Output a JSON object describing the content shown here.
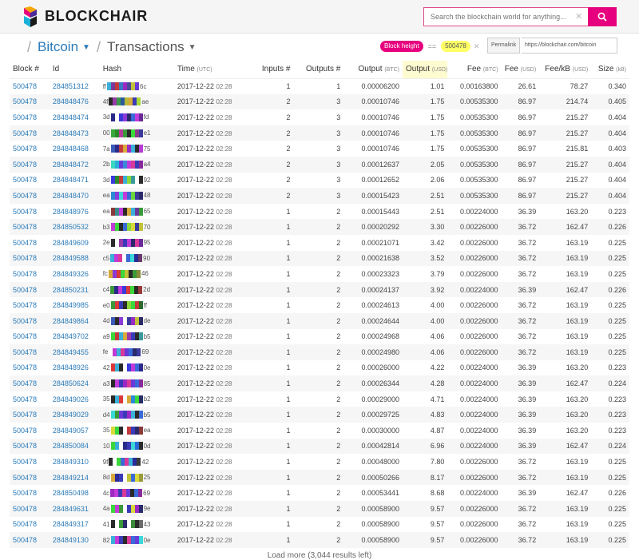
{
  "header": {
    "logo_text": "BLOCKCHAIR",
    "search_placeholder": "Search the blockchain world for anything..."
  },
  "breadcrumb": {
    "chain": "Bitcoin",
    "section": "Transactions"
  },
  "filter": {
    "field": "Block height",
    "operator": "==",
    "value": "500478"
  },
  "permalink": {
    "label": "Permalink",
    "url": "https://blockchair.com/bitcoin"
  },
  "columns": {
    "block": "Block #",
    "id": "Id",
    "hash": "Hash",
    "time": "Time",
    "time_unit": "(UTC)",
    "inputs": "Inputs #",
    "outputs": "Outputs #",
    "output_btc": "Output",
    "output_btc_unit": "(BTC)",
    "output_usd": "Output",
    "output_usd_unit": "(USD)",
    "fee_btc": "Fee",
    "fee_btc_unit": "(BTC)",
    "fee_usd": "Fee",
    "fee_usd_unit": "(USD)",
    "fee_kb": "Fee/kB",
    "fee_kb_unit": "(USD)",
    "size": "Size",
    "size_unit": "(kB)"
  },
  "rows": [
    {
      "block": "500478",
      "id": "284851312",
      "hash_start": "ff",
      "hash_end": "6c",
      "date": "2017-12-22",
      "time": "02:28",
      "inputs": "1",
      "outputs": "1",
      "output_btc": "0.00006200",
      "output_usd": "1.01",
      "fee_btc": "0.00163800",
      "fee_usd": "26.61",
      "fee_kb": "78.27",
      "size": "0.340",
      "colors": [
        "#3ab0d8",
        "#7a3a9a",
        "#c23a3a",
        "#3a7ac2",
        "#9a2ac2",
        "#4a4a9a",
        "#c2c23a",
        "#6a3ad8"
      ]
    },
    {
      "block": "500478",
      "id": "284848476",
      "hash_start": "4f",
      "hash_end": "ae",
      "date": "2017-12-22",
      "time": "02:28",
      "inputs": "2",
      "outputs": "3",
      "output_btc": "0.00010746",
      "output_usd": "1.75",
      "fee_btc": "0.00535300",
      "fee_usd": "86.97",
      "fee_kb": "214.74",
      "size": "0.405",
      "colors": [
        "#2a2a2a",
        "#9a3aa8",
        "#3a9a4a",
        "#2a5a9a",
        "#b8b83a",
        "#d8a83a",
        "#3a3ab8",
        "#a8d83a"
      ]
    },
    {
      "block": "500478",
      "id": "284848474",
      "hash_start": "3d",
      "hash_end": "fd",
      "date": "2017-12-22",
      "time": "02:28",
      "inputs": "2",
      "outputs": "3",
      "output_btc": "0.00010746",
      "output_usd": "1.75",
      "fee_btc": "0.00535300",
      "fee_usd": "86.97",
      "fee_kb": "215.27",
      "size": "0.404",
      "colors": [
        "#2a2a8a",
        "#ffffff",
        "#3a3ad8",
        "#8a3ad8",
        "#2a2a6a",
        "#3a6ad8",
        "#c23ad8",
        "#6a2a9a"
      ]
    },
    {
      "block": "500478",
      "id": "284848473",
      "hash_start": "00",
      "hash_end": "e1",
      "date": "2017-12-22",
      "time": "02:28",
      "inputs": "2",
      "outputs": "3",
      "output_btc": "0.00010746",
      "output_usd": "1.75",
      "fee_btc": "0.00535300",
      "fee_usd": "86.97",
      "fee_kb": "215.27",
      "size": "0.404",
      "colors": [
        "#3aa83a",
        "#2a8a2a",
        "#b83a9a",
        "#3a9a3a",
        "#2a2a2a",
        "#3ad83a",
        "#8a3a8a",
        "#3a3a9a"
      ]
    },
    {
      "block": "500478",
      "id": "284848468",
      "hash_start": "7a",
      "hash_end": "75",
      "date": "2017-12-22",
      "time": "02:28",
      "inputs": "2",
      "outputs": "3",
      "output_btc": "0.00010746",
      "output_usd": "1.75",
      "fee_btc": "0.00535300",
      "fee_usd": "86.97",
      "fee_kb": "215.81",
      "size": "0.403",
      "colors": [
        "#3a5ab8",
        "#2a2a8a",
        "#c23a3a",
        "#d8a83a",
        "#9a2ac2",
        "#3ab0d8",
        "#2a2a2a",
        "#b83ad8"
      ]
    },
    {
      "block": "500478",
      "id": "284848472",
      "hash_start": "2b",
      "hash_end": "a4",
      "date": "2017-12-22",
      "time": "02:28",
      "inputs": "2",
      "outputs": "3",
      "output_btc": "0.00012637",
      "output_usd": "2.05",
      "fee_btc": "0.00535300",
      "fee_usd": "86.97",
      "fee_kb": "215.27",
      "size": "0.404",
      "colors": [
        "#3ad8c2",
        "#2ab0d8",
        "#6a3ad8",
        "#3a8ad8",
        "#c23ad8",
        "#d83a9a",
        "#3a3ab8",
        "#8a2a9a"
      ]
    },
    {
      "block": "500478",
      "id": "284848471",
      "hash_start": "3d",
      "hash_end": "92",
      "date": "2017-12-22",
      "time": "02:28",
      "inputs": "2",
      "outputs": "3",
      "output_btc": "0.00012652",
      "output_usd": "2.06",
      "fee_btc": "0.00535300",
      "fee_usd": "86.97",
      "fee_kb": "215.27",
      "size": "0.404",
      "colors": [
        "#3a3ad8",
        "#2a8a2a",
        "#c23a3a",
        "#3ab0d8",
        "#8ad83a",
        "#3a9a9a",
        "#ffffff",
        "#2a2a2a"
      ]
    },
    {
      "block": "500478",
      "id": "284848470",
      "hash_start": "ea",
      "hash_end": "48",
      "date": "2017-12-22",
      "time": "02:28",
      "inputs": "2",
      "outputs": "3",
      "output_btc": "0.00015423",
      "output_usd": "2.51",
      "fee_btc": "0.00535300",
      "fee_usd": "86.97",
      "fee_kb": "215.27",
      "size": "0.404",
      "colors": [
        "#2a8ad8",
        "#8a3ad8",
        "#3ad8d8",
        "#c23ad8",
        "#3a6ad8",
        "#6ad83a",
        "#3a3a9a",
        "#2a2a6a"
      ]
    },
    {
      "block": "500478",
      "id": "284848976",
      "hash_start": "ea",
      "hash_end": "65",
      "date": "2017-12-22",
      "time": "02:28",
      "inputs": "1",
      "outputs": "2",
      "output_btc": "0.00015443",
      "output_usd": "2.51",
      "fee_btc": "0.00224000",
      "fee_usd": "36.39",
      "fee_kb": "163.20",
      "size": "0.223",
      "colors": [
        "#8a3a3a",
        "#3a8a8a",
        "#c23ad8",
        "#2a2a2a",
        "#d8a83a",
        "#3ab0d8",
        "#6a3a9a",
        "#3a9a3a"
      ]
    },
    {
      "block": "500478",
      "id": "284850532",
      "hash_start": "b3",
      "hash_end": "70",
      "date": "2017-12-22",
      "time": "02:28",
      "inputs": "1",
      "outputs": "2",
      "output_btc": "0.00020292",
      "output_usd": "3.30",
      "fee_btc": "0.00226000",
      "fee_usd": "36.72",
      "fee_kb": "162.47",
      "size": "0.226",
      "colors": [
        "#c23ad8",
        "#3ad83a",
        "#2a2a2a",
        "#3a6ad8",
        "#8ad83a",
        "#d8d83a",
        "#3a3a9a",
        "#c2c23a"
      ]
    },
    {
      "block": "500478",
      "id": "284849609",
      "hash_start": "2e",
      "hash_end": "95",
      "date": "2017-12-22",
      "time": "02:28",
      "inputs": "1",
      "outputs": "2",
      "output_btc": "0.00021071",
      "output_usd": "3.42",
      "fee_btc": "0.00226000",
      "fee_usd": "36.72",
      "fee_kb": "163.19",
      "size": "0.225",
      "colors": [
        "#2a2a2a",
        "#ffffff",
        "#9a3aa8",
        "#3a3ab8",
        "#c23ad8",
        "#2a2a6a",
        "#d83a9a",
        "#6a2a9a"
      ]
    },
    {
      "block": "500478",
      "id": "284849588",
      "hash_start": "c5",
      "hash_end": "90",
      "date": "2017-12-22",
      "time": "02:28",
      "inputs": "1",
      "outputs": "2",
      "output_btc": "0.00021638",
      "output_usd": "3.52",
      "fee_btc": "0.00226000",
      "fee_usd": "36.72",
      "fee_kb": "163.19",
      "size": "0.225",
      "colors": [
        "#3ab0d8",
        "#c23ad8",
        "#d83a9a",
        "#ffffff",
        "#3a6ad8",
        "#3ad8d8",
        "#2a2a9a",
        "#6a3a6a"
      ]
    },
    {
      "block": "500478",
      "id": "284849326",
      "hash_start": "fc",
      "hash_end": "46",
      "date": "2017-12-22",
      "time": "02:28",
      "inputs": "1",
      "outputs": "2",
      "output_btc": "0.00023323",
      "output_usd": "3.79",
      "fee_btc": "0.00226000",
      "fee_usd": "36.72",
      "fee_kb": "163.19",
      "size": "0.225",
      "colors": [
        "#d8a83a",
        "#8a3ad8",
        "#d83a3a",
        "#3ad83a",
        "#c2c23a",
        "#2a2a2a",
        "#3a9a3a",
        "#8a8a3a"
      ]
    },
    {
      "block": "500478",
      "id": "284850231",
      "hash_start": "c4",
      "hash_end": "2d",
      "date": "2017-12-22",
      "time": "02:28",
      "inputs": "1",
      "outputs": "2",
      "output_btc": "0.00024137",
      "output_usd": "3.92",
      "fee_btc": "0.00224000",
      "fee_usd": "36.39",
      "fee_kb": "162.47",
      "size": "0.226",
      "colors": [
        "#3a9a3a",
        "#2a2a8a",
        "#c23ad8",
        "#3a3ad8",
        "#d83a3a",
        "#3ad83a",
        "#2a2a2a",
        "#9a3a3a"
      ]
    },
    {
      "block": "500478",
      "id": "284849985",
      "hash_start": "e0",
      "hash_end": "ff",
      "date": "2017-12-22",
      "time": "02:28",
      "inputs": "1",
      "outputs": "2",
      "output_btc": "0.00024613",
      "output_usd": "4.00",
      "fee_btc": "0.00226000",
      "fee_usd": "36.72",
      "fee_kb": "163.19",
      "size": "0.225",
      "colors": [
        "#3a9a3a",
        "#d83a3a",
        "#3a3ab8",
        "#2a2a2a",
        "#8ad83a",
        "#3ad83a",
        "#c23a3a",
        "#2a6a2a"
      ]
    },
    {
      "block": "500478",
      "id": "284849864",
      "hash_start": "4d",
      "hash_end": "de",
      "date": "2017-12-22",
      "time": "02:28",
      "inputs": "1",
      "outputs": "2",
      "output_btc": "0.00024644",
      "output_usd": "4.00",
      "fee_btc": "0.00226000",
      "fee_usd": "36.72",
      "fee_kb": "163.19",
      "size": "0.225",
      "colors": [
        "#3a5ab8",
        "#2a2a2a",
        "#8a3ad8",
        "#ffffff",
        "#3a3a9a",
        "#9a2ac2",
        "#c2c23a",
        "#2a2a6a"
      ]
    },
    {
      "block": "500478",
      "id": "284849702",
      "hash_start": "a9",
      "hash_end": "b5",
      "date": "2017-12-22",
      "time": "02:28",
      "inputs": "1",
      "outputs": "2",
      "output_btc": "0.00024968",
      "output_usd": "4.06",
      "fee_btc": "0.00226000",
      "fee_usd": "36.72",
      "fee_kb": "163.19",
      "size": "0.225",
      "colors": [
        "#3ad83a",
        "#c23a3a",
        "#3ab0d8",
        "#d8a83a",
        "#9a3aa8",
        "#3a3ab8",
        "#2a2a2a",
        "#3a9a9a"
      ]
    },
    {
      "block": "500478",
      "id": "284849455",
      "hash_start": "fe",
      "hash_end": "69",
      "date": "2017-12-22",
      "time": "02:28",
      "inputs": "1",
      "outputs": "2",
      "output_btc": "0.00024980",
      "output_usd": "4.06",
      "fee_btc": "0.00226000",
      "fee_usd": "36.72",
      "fee_kb": "163.19",
      "size": "0.225",
      "colors": [
        "#ffffff",
        "#c23ad8",
        "#3ab0d8",
        "#d83a9a",
        "#6a3ad8",
        "#3a6ad8",
        "#2a2a6a",
        "#3a3a9a"
      ]
    },
    {
      "block": "500478",
      "id": "284848926",
      "hash_start": "42",
      "hash_end": "0e",
      "date": "2017-12-22",
      "time": "02:28",
      "inputs": "1",
      "outputs": "2",
      "output_btc": "0.00026000",
      "output_usd": "4.22",
      "fee_btc": "0.00224000",
      "fee_usd": "36.39",
      "fee_kb": "163.20",
      "size": "0.223",
      "colors": [
        "#d83a3a",
        "#3ab0d8",
        "#2a2a2a",
        "#ffffff",
        "#3a3ad8",
        "#c23ad8",
        "#3a6ad8",
        "#2a2a8a"
      ]
    },
    {
      "block": "500478",
      "id": "284850624",
      "hash_start": "a3",
      "hash_end": "85",
      "date": "2017-12-22",
      "time": "02:28",
      "inputs": "1",
      "outputs": "2",
      "output_btc": "0.00026344",
      "output_usd": "4.28",
      "fee_btc": "0.00224000",
      "fee_usd": "36.39",
      "fee_kb": "162.47",
      "size": "0.224",
      "colors": [
        "#2a2a2a",
        "#c23ad8",
        "#3a3ab8",
        "#9a2ac2",
        "#d83a9a",
        "#6a3ad8",
        "#3a6ad8",
        "#8a2a9a"
      ]
    },
    {
      "block": "500478",
      "id": "284849026",
      "hash_start": "35",
      "hash_end": "b2",
      "date": "2017-12-22",
      "time": "02:28",
      "inputs": "1",
      "outputs": "2",
      "output_btc": "0.00029000",
      "output_usd": "4.71",
      "fee_btc": "0.00224000",
      "fee_usd": "36.39",
      "fee_kb": "163.20",
      "size": "0.223",
      "colors": [
        "#2a2a2a",
        "#3ab0d8",
        "#d83a3a",
        "#ffffff",
        "#d8a83a",
        "#2a8ad8",
        "#3ad83a",
        "#2a2a6a"
      ]
    },
    {
      "block": "500478",
      "id": "284849029",
      "hash_start": "d4",
      "hash_end": "b5",
      "date": "2017-12-22",
      "time": "02:28",
      "inputs": "1",
      "outputs": "2",
      "output_btc": "0.00029725",
      "output_usd": "4.83",
      "fee_btc": "0.00224000",
      "fee_usd": "36.39",
      "fee_kb": "163.20",
      "size": "0.223",
      "colors": [
        "#3ad8d8",
        "#3a9a3a",
        "#6a3ad8",
        "#3a3ab8",
        "#9a2ac2",
        "#3ab0d8",
        "#2a2a2a",
        "#3a6ad8"
      ]
    },
    {
      "block": "500478",
      "id": "284849057",
      "hash_start": "35",
      "hash_end": "ea",
      "date": "2017-12-22",
      "time": "02:28",
      "inputs": "1",
      "outputs": "2",
      "output_btc": "0.00030000",
      "output_usd": "4.87",
      "fee_btc": "0.00224000",
      "fee_usd": "36.39",
      "fee_kb": "163.20",
      "size": "0.223",
      "colors": [
        "#d8d83a",
        "#3ad83a",
        "#2a2a2a",
        "#ffffff",
        "#c23a3a",
        "#3a3ab8",
        "#2a2a6a",
        "#8a3a3a"
      ]
    },
    {
      "block": "500478",
      "id": "284850084",
      "hash_start": "10",
      "hash_end": "0d",
      "date": "2017-12-22",
      "time": "02:28",
      "inputs": "1",
      "outputs": "2",
      "output_btc": "0.00042814",
      "output_usd": "6.96",
      "fee_btc": "0.00224000",
      "fee_usd": "36.39",
      "fee_kb": "162.47",
      "size": "0.224",
      "colors": [
        "#3ad83a",
        "#3ab0d8",
        "#ffffff",
        "#2a2a8a",
        "#3a3ab8",
        "#3ad8d8",
        "#2a6ad8",
        "#2a2a2a"
      ]
    },
    {
      "block": "500478",
      "id": "284849310",
      "hash_start": "9f",
      "hash_end": "42",
      "date": "2017-12-22",
      "time": "02:28",
      "inputs": "1",
      "outputs": "2",
      "output_btc": "0.00048000",
      "output_usd": "7.80",
      "fee_btc": "0.00226000",
      "fee_usd": "36.72",
      "fee_kb": "163.19",
      "size": "0.225",
      "colors": [
        "#2a2a2a",
        "#ffffff",
        "#3ad83a",
        "#3a6ad8",
        "#d83a9a",
        "#3ab0d8",
        "#2a2a9a",
        "#3a3a3a"
      ]
    },
    {
      "block": "500478",
      "id": "284849214",
      "hash_start": "8d",
      "hash_end": "25",
      "date": "2017-12-22",
      "time": "02:28",
      "inputs": "1",
      "outputs": "2",
      "output_btc": "0.00050266",
      "output_usd": "8.17",
      "fee_btc": "0.00226000",
      "fee_usd": "36.72",
      "fee_kb": "163.19",
      "size": "0.225",
      "colors": [
        "#d8a83a",
        "#2a2a9a",
        "#3a3ab8",
        "#ffffff",
        "#c2c23a",
        "#3a6ad8",
        "#d8d83a",
        "#9a9a3a"
      ]
    },
    {
      "block": "500478",
      "id": "284850498",
      "hash_start": "4c",
      "hash_end": "69",
      "date": "2017-12-22",
      "time": "02:28",
      "inputs": "1",
      "outputs": "2",
      "output_btc": "0.00053441",
      "output_usd": "8.68",
      "fee_btc": "0.00224000",
      "fee_usd": "36.39",
      "fee_kb": "162.47",
      "size": "0.226",
      "colors": [
        "#9a2ac2",
        "#c23ad8",
        "#3a3ab8",
        "#d83a9a",
        "#6a3ad8",
        "#2a2a2a",
        "#3a6ad8",
        "#8a2a9a"
      ]
    },
    {
      "block": "500478",
      "id": "284849631",
      "hash_start": "4a",
      "hash_end": "9e",
      "date": "2017-12-22",
      "time": "02:28",
      "inputs": "1",
      "outputs": "2",
      "output_btc": "0.00058900",
      "output_usd": "9.57",
      "fee_btc": "0.00226000",
      "fee_usd": "36.72",
      "fee_kb": "163.19",
      "size": "0.225",
      "colors": [
        "#3ad83a",
        "#c23ad8",
        "#3a9a3a",
        "#ffffff",
        "#3a3ab8",
        "#d8d83a",
        "#9a2ac2",
        "#2a2a6a"
      ]
    },
    {
      "block": "500478",
      "id": "284849317",
      "hash_start": "41",
      "hash_end": "43",
      "date": "2017-12-22",
      "time": "02:28",
      "inputs": "1",
      "outputs": "2",
      "output_btc": "0.00058900",
      "output_usd": "9.57",
      "fee_btc": "0.00226000",
      "fee_usd": "36.72",
      "fee_kb": "163.19",
      "size": "0.225",
      "colors": [
        "#2a2a2a",
        "#ffffff",
        "#3a9a3a",
        "#2a2a6a",
        "#ffffff",
        "#3a8a3a",
        "#2a2a2a",
        "#6a6a6a"
      ]
    },
    {
      "block": "500478",
      "id": "284849130",
      "hash_start": "82",
      "hash_end": "0e",
      "date": "2017-12-22",
      "time": "02:28",
      "inputs": "1",
      "outputs": "2",
      "output_btc": "0.00058900",
      "output_usd": "9.57",
      "fee_btc": "0.00226000",
      "fee_usd": "36.72",
      "fee_kb": "163.19",
      "size": "0.225",
      "colors": [
        "#3ab0d8",
        "#c23ad8",
        "#3a3ab8",
        "#2a2a2a",
        "#d83a9a",
        "#3a6ad8",
        "#6a3ad8",
        "#3ad8d8"
      ]
    }
  ],
  "footer": {
    "load_more": "Load more (3,044 results left)"
  },
  "colors": {
    "brand": "#e6007e",
    "link": "#2b7bb9",
    "filter_value_bg": "#ffff66"
  }
}
